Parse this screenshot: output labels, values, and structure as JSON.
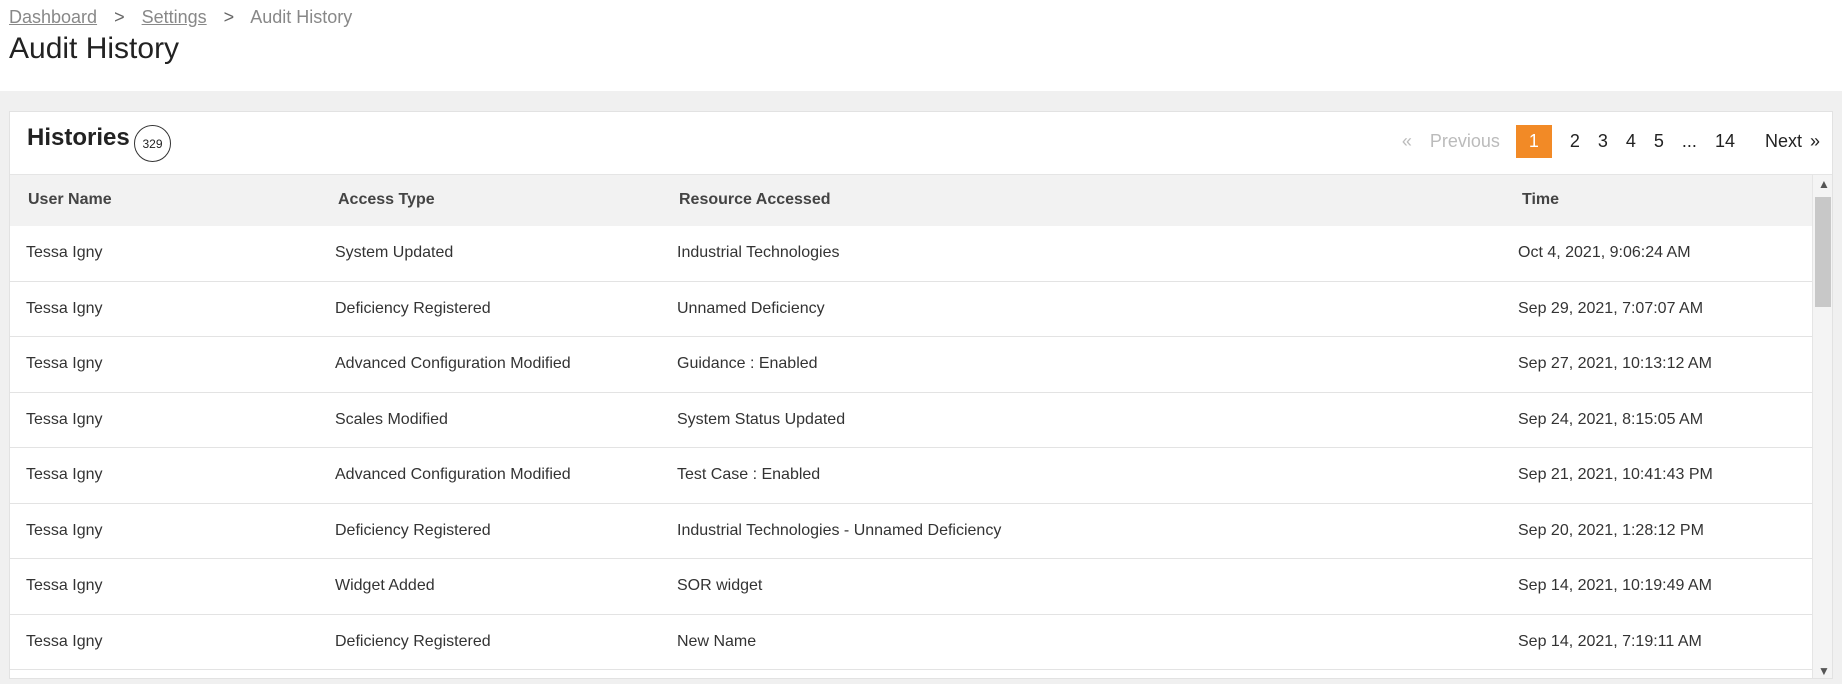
{
  "breadcrumb": {
    "items": [
      "Dashboard",
      "Settings",
      "Audit History"
    ],
    "separator": ">"
  },
  "page_title": "Audit History",
  "card": {
    "title": "Histories",
    "count": "329",
    "pager": {
      "prev_arrow": "«",
      "previous": "Previous",
      "pages": [
        "1",
        "2",
        "3",
        "4",
        "5",
        "...",
        "14"
      ],
      "active_page": "1",
      "next": "Next",
      "next_arrow": "»"
    }
  },
  "table": {
    "headers": {
      "user": "User Name",
      "access": "Access Type",
      "resource": "Resource Accessed",
      "time": "Time"
    },
    "rows": [
      {
        "user": "Tessa Igny",
        "access": "System Updated",
        "resource": "Industrial Technologies",
        "time": "Oct 4, 2021, 9:06:24 AM"
      },
      {
        "user": "Tessa Igny",
        "access": "Deficiency Registered",
        "resource": "Unnamed Deficiency",
        "time": "Sep 29, 2021, 7:07:07 AM"
      },
      {
        "user": "Tessa Igny",
        "access": "Advanced Configuration Modified",
        "resource": "Guidance : Enabled",
        "time": "Sep 27, 2021, 10:13:12 AM"
      },
      {
        "user": "Tessa Igny",
        "access": "Scales Modified",
        "resource": "System Status Updated",
        "time": "Sep 24, 2021, 8:15:05 AM"
      },
      {
        "user": "Tessa Igny",
        "access": "Advanced Configuration Modified",
        "resource": "Test Case : Enabled",
        "time": "Sep 21, 2021, 10:41:43 PM"
      },
      {
        "user": "Tessa Igny",
        "access": "Deficiency Registered",
        "resource": "Industrial Technologies - Unnamed Deficiency",
        "time": "Sep 20, 2021, 1:28:12 PM"
      },
      {
        "user": "Tessa Igny",
        "access": "Widget Added",
        "resource": "SOR widget",
        "time": "Sep 14, 2021, 10:19:49 AM"
      },
      {
        "user": "Tessa Igny",
        "access": "Deficiency Registered",
        "resource": "New Name",
        "time": "Sep 14, 2021, 7:19:11 AM"
      }
    ]
  },
  "scrollbar": {
    "up_icon": "▲",
    "down_icon": "▼"
  },
  "colors": {
    "accent": "#f28a26",
    "header_bg": "#f2f2f2",
    "page_bg": "#f0f0f0"
  }
}
